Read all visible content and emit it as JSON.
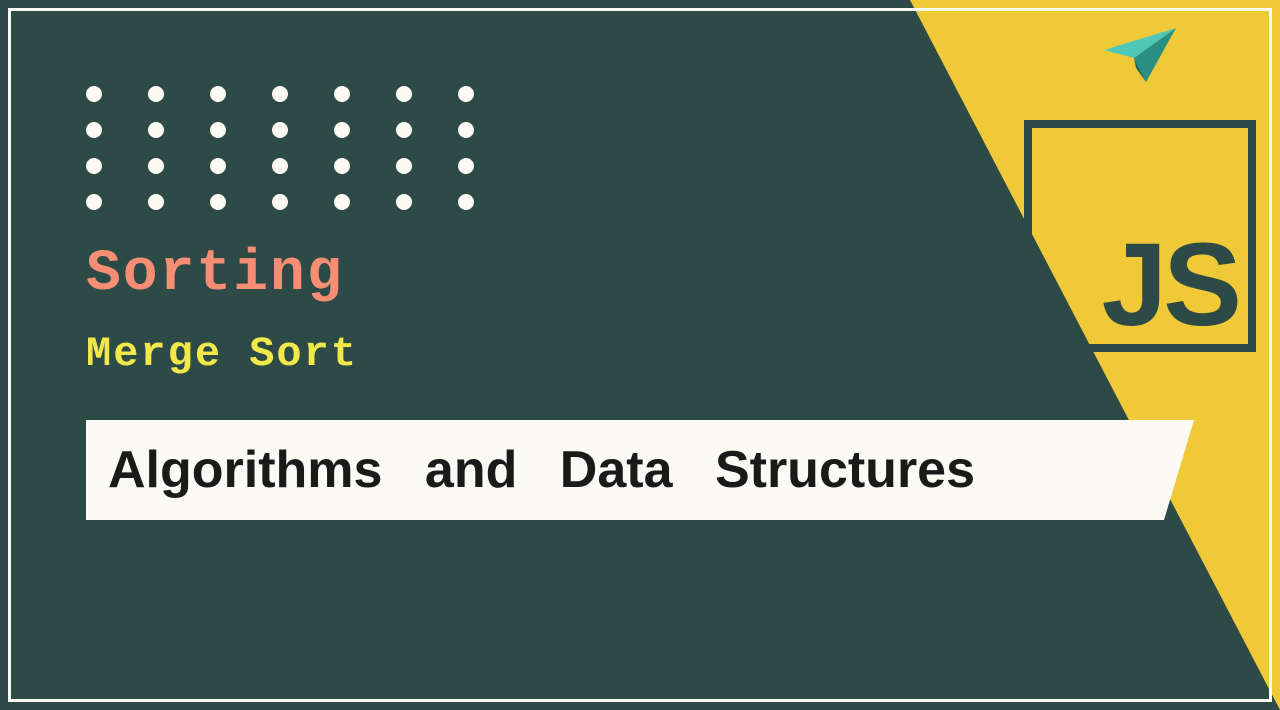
{
  "titles": {
    "primary": "Sorting",
    "secondary": "Merge Sort"
  },
  "banner": {
    "text": "Algorithms and Data Structures"
  },
  "logo": {
    "label": "JS"
  },
  "decor": {
    "dot_rows": 4,
    "dot_cols": 7
  },
  "colors": {
    "bg": "#2d4a47",
    "accent_yellow": "#f0c938",
    "text_primary": "#f58e74",
    "text_secondary": "#f2e84a",
    "banner_bg": "#fbfaf5",
    "banner_text": "#1a1a1a",
    "plane_teal": "#4ec9b8"
  }
}
